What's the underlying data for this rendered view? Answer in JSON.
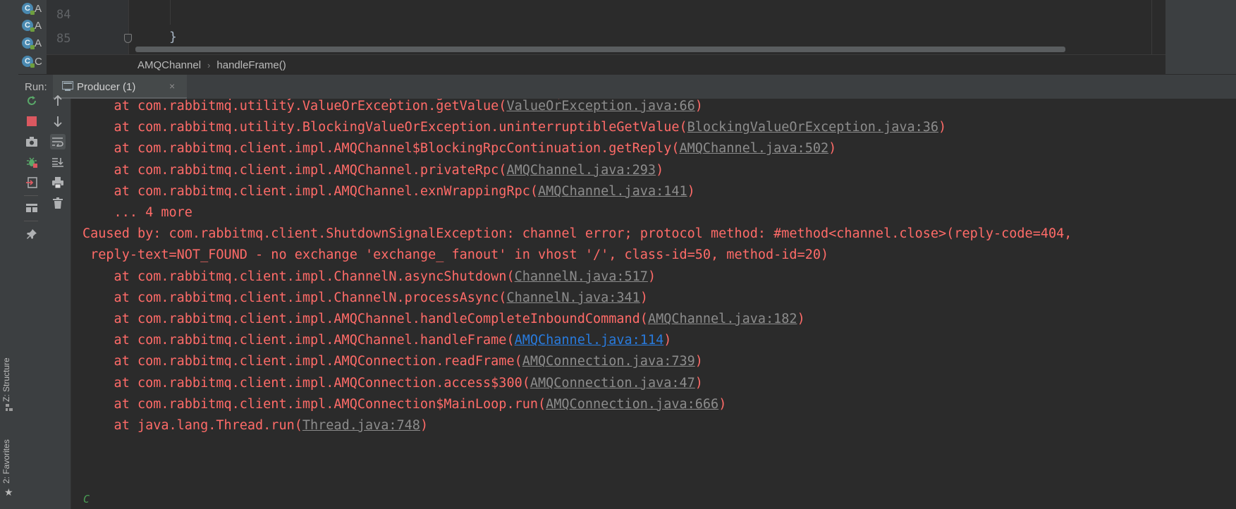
{
  "side_tabs": {
    "structure": "Z: Structure",
    "favorites": "2: Favorites"
  },
  "project_tree": {
    "items": [
      {
        "badge": "C",
        "label": "A"
      },
      {
        "badge": "C",
        "label": "A"
      },
      {
        "badge": "C",
        "label": "A"
      },
      {
        "badge": "C",
        "label": "C"
      }
    ]
  },
  "editor": {
    "line_numbers": [
      "84",
      "85"
    ],
    "code_line_85": "}"
  },
  "breadcrumb": {
    "items": [
      "AMQChannel",
      "handleFrame()"
    ],
    "separator": "›"
  },
  "run_panel": {
    "label": "Run:",
    "tab_label": "Producer (1)",
    "tab_close": "×"
  },
  "console": {
    "lines": [
      {
        "prefix": "\tat com.rabbitmq.utility.ValueOrException.getValue(",
        "link": "ValueOrException.java:66",
        "suffix": ")"
      },
      {
        "prefix": "\tat com.rabbitmq.utility.BlockingValueOrException.uninterruptibleGetValue(",
        "link": "BlockingValueOrException.java:36",
        "suffix": ")"
      },
      {
        "prefix": "\tat com.rabbitmq.client.impl.AMQChannel$BlockingRpcContinuation.getReply(",
        "link": "AMQChannel.java:502",
        "suffix": ")"
      },
      {
        "prefix": "\tat com.rabbitmq.client.impl.AMQChannel.privateRpc(",
        "link": "AMQChannel.java:293",
        "suffix": ")"
      },
      {
        "prefix": "\tat com.rabbitmq.client.impl.AMQChannel.exnWrappingRpc(",
        "link": "AMQChannel.java:141",
        "suffix": ")"
      },
      {
        "prefix": "\t... 4 more",
        "link": "",
        "suffix": ""
      },
      {
        "prefix": "Caused by: com.rabbitmq.client.ShutdownSignalException: channel error; protocol method: #method<channel.close>(reply-code=404,",
        "link": "",
        "suffix": ""
      },
      {
        "prefix": " reply-text=NOT_FOUND - no exchange 'exchange_ fanout' in vhost '/', class-id=50, method-id=20)",
        "link": "",
        "suffix": ""
      },
      {
        "prefix": "\tat com.rabbitmq.client.impl.ChannelN.asyncShutdown(",
        "link": "ChannelN.java:517",
        "suffix": ")"
      },
      {
        "prefix": "\tat com.rabbitmq.client.impl.ChannelN.processAsync(",
        "link": "ChannelN.java:341",
        "suffix": ")"
      },
      {
        "prefix": "\tat com.rabbitmq.client.impl.AMQChannel.handleCompleteInboundCommand(",
        "link": "AMQChannel.java:182",
        "suffix": ")"
      },
      {
        "prefix": "\tat com.rabbitmq.client.impl.AMQChannel.handleFrame(",
        "link": "AMQChannel.java:114",
        "suffix": ")",
        "active": true
      },
      {
        "prefix": "\tat com.rabbitmq.client.impl.AMQConnection.readFrame(",
        "link": "AMQConnection.java:739",
        "suffix": ")"
      },
      {
        "prefix": "\tat com.rabbitmq.client.impl.AMQConnection.access$300(",
        "link": "AMQConnection.java:47",
        "suffix": ")"
      },
      {
        "prefix": "\tat com.rabbitmq.client.impl.AMQConnection$MainLoop.run(",
        "link": "AMQConnection.java:666",
        "suffix": ")"
      },
      {
        "prefix": "\tat java.lang.Thread.run(",
        "link": "Thread.java:748",
        "suffix": ")"
      }
    ],
    "prompt_glyph": "C"
  },
  "toolbar": {
    "rerun": "rerun-icon",
    "stop": "stop-icon",
    "screenshot": "camera-icon",
    "debug": "debug-icon",
    "exit": "exit-icon",
    "layout": "layout-icon",
    "pin": "pin-icon",
    "up": "arrow-up-icon",
    "down": "arrow-down-icon",
    "wrap": "soft-wrap-icon",
    "scroll_end": "scroll-to-end-icon",
    "print": "print-icon",
    "clear": "trash-icon"
  },
  "colors": {
    "error_text": "#ff6b68",
    "link_gray": "#8c8c8c",
    "link_active": "#287bde",
    "background": "#2b2b2b",
    "panel": "#3c3f41"
  }
}
